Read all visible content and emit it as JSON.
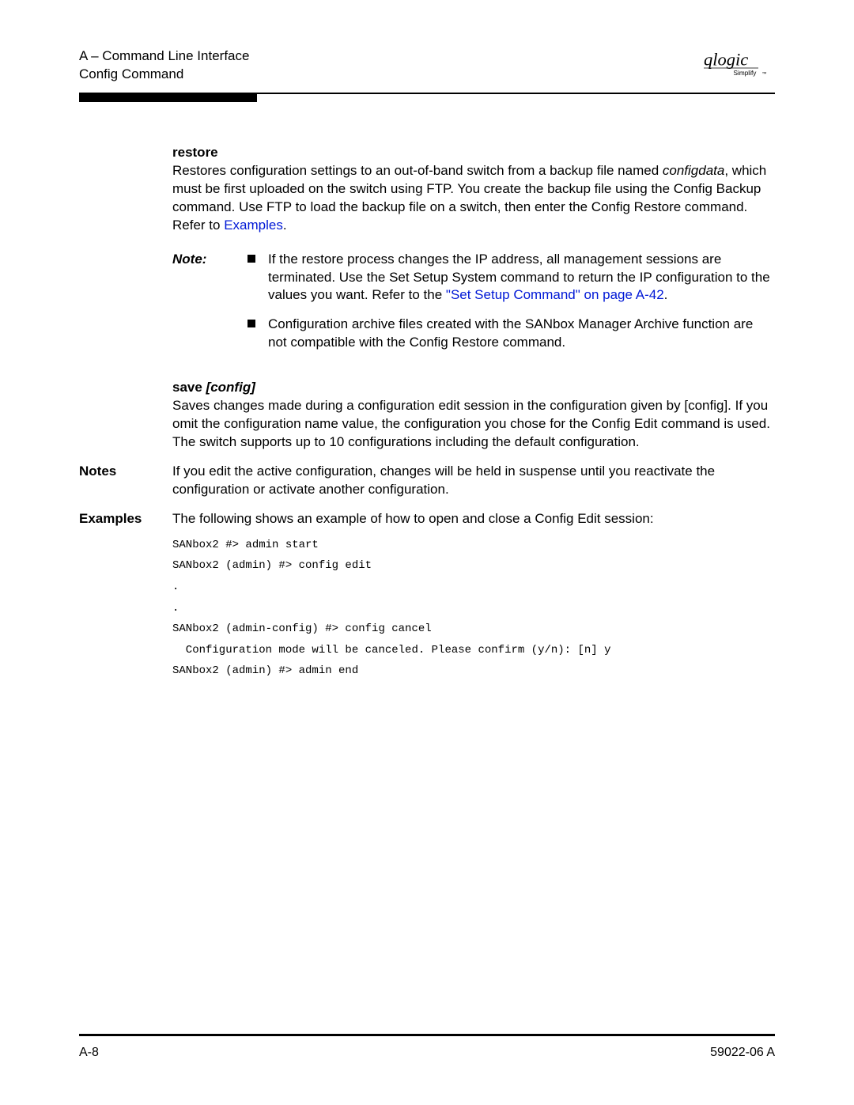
{
  "header": {
    "line1": "A – Command Line Interface",
    "line2": "Config Command",
    "logo_main": "qlogic",
    "logo_sub": "Simplify"
  },
  "restore": {
    "term": "restore",
    "text_a": "Restores configuration settings to an out-of-band switch from a backup file named ",
    "filename": "configdata",
    "text_b": ", which must be first uploaded on the switch using FTP. You create the backup file using the Config Backup command. Use FTP to load the backup file on a switch, then enter the Config Restore command. Refer to ",
    "link": "Examples",
    "text_c": "."
  },
  "note": {
    "label": "Note:",
    "item1_a": "If the restore process changes the IP address, all management sessions are terminated. Use the Set Setup System command to return the IP configuration to the values you want. Refer to the ",
    "item1_link": "\"Set Setup Command\" on page A-42",
    "item1_b": ".",
    "item2": "Configuration archive files created with the SANbox Manager Archive function are not compatible with the Config Restore command."
  },
  "save": {
    "term_a": "save ",
    "term_b": "[config]",
    "text": "Saves changes made during a configuration edit session in the configuration given by [config]. If you omit the configuration name value, the configuration you chose for the Config Edit command is used. The switch supports up to 10 configurations including the default configuration."
  },
  "notes_section": {
    "label": "Notes",
    "text": "If you edit the active configuration, changes will be held in suspense until you reactivate the configuration or activate another configuration."
  },
  "examples_section": {
    "label": "Examples",
    "text": "The following shows an example of how to open and close a Config Edit session:",
    "code": "SANbox2 #> admin start\nSANbox2 (admin) #> config edit\n.\n.\nSANbox2 (admin-config) #> config cancel\n  Configuration mode will be canceled. Please confirm (y/n): [n] y\nSANbox2 (admin) #> admin end"
  },
  "footer": {
    "left": "A-8",
    "right": "59022-06 A"
  }
}
